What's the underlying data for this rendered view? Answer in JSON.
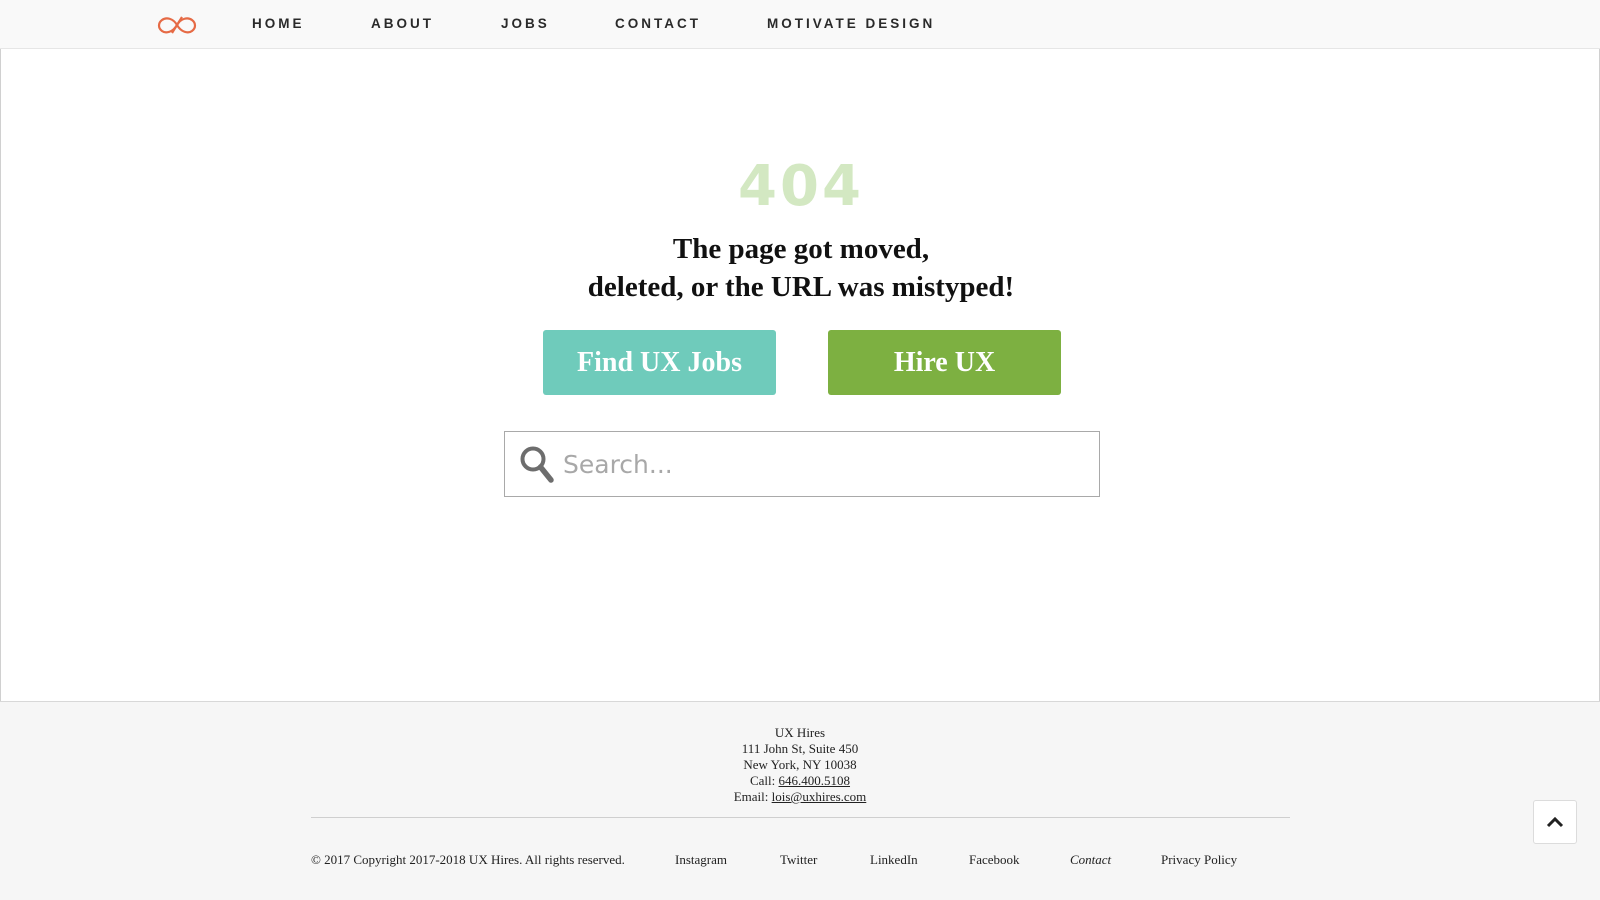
{
  "nav": {
    "logo_icon": "infinity-logo-icon",
    "accent_color": "#e66a45",
    "items": [
      {
        "label": "HOME"
      },
      {
        "label": "ABOUT"
      },
      {
        "label": "JOBS"
      },
      {
        "label": "CONTACT"
      },
      {
        "label": "MOTIVATE DESIGN"
      }
    ]
  },
  "error": {
    "code": "404",
    "line1": "The page got moved,",
    "line2": "deleted, or the URL was mistyped!"
  },
  "buttons": {
    "find_jobs": {
      "label": "Find UX Jobs",
      "color": "#6fcbbb"
    },
    "hire": {
      "label": "Hire UX",
      "color": "#7db041"
    }
  },
  "search": {
    "placeholder": "Search...",
    "value": "",
    "icon": "search-icon"
  },
  "footer": {
    "company": "UX Hires",
    "street": "111 John St, Suite 450",
    "city": "New York, NY 10038",
    "call_label": "Call:",
    "phone": "646.400.5108",
    "email_label": "Email:",
    "email": "lois@uxhires.com",
    "copyright": "© 2017 Copyright 2017-2018 UX Hires. All rights reserved.",
    "links": [
      {
        "label": "Instagram"
      },
      {
        "label": "Twitter"
      },
      {
        "label": "LinkedIn"
      },
      {
        "label": "Facebook"
      },
      {
        "label": "Contact"
      },
      {
        "label": "Privacy Policy"
      }
    ],
    "back_to_top_icon": "chevron-up-icon"
  }
}
